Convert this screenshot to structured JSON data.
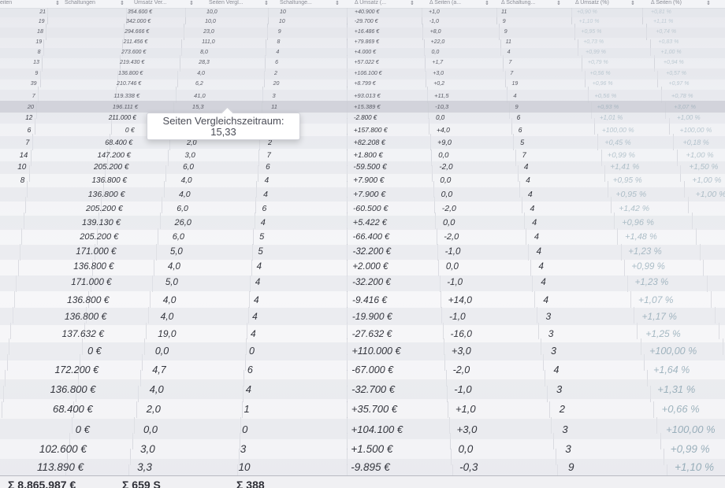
{
  "table": {
    "headers": [
      "eiten",
      "Schaltungen",
      "Umsatz Ver...",
      "Seiten Vergl...",
      "Schaltunge...",
      "Δ Umsatz (...",
      "Δ Seiten (a...",
      "Δ Schaltung...",
      "Δ Umsatz (%)",
      "Δ Seiten (%)"
    ],
    "rows": [
      [
        "21",
        "354.600 €",
        "10,0",
        "10",
        "+40.900 €",
        "+1,0",
        "11",
        "+0,90 %",
        "+0,81 %"
      ],
      [
        "19",
        "342.000 €",
        "10,0",
        "10",
        "-29.700 €",
        "-1,0",
        "9",
        "+1,10 %",
        "+1,11 %"
      ],
      [
        "18",
        "294.666 €",
        "23,0",
        "9",
        "+16.486 €",
        "+8,0",
        "9",
        "+0,95 %",
        "+0,74 %"
      ],
      [
        "19",
        "211.456 €",
        "111,0",
        "8",
        "+79.869 €",
        "+22,0",
        "11",
        "+0,73 %",
        "+0,83 %"
      ],
      [
        "8",
        "273.600 €",
        "8,0",
        "4",
        "+4.000 €",
        "0,0",
        "4",
        "+0,99 %",
        "+1,00 %"
      ],
      [
        "13",
        "219.430 €",
        "28,3",
        "6",
        "+57.022 €",
        "+1,7",
        "7",
        "+0,79 %",
        "+0,94 %"
      ],
      [
        "9",
        "136.800 €",
        "4,0",
        "2",
        "+106.100 €",
        "+3,0",
        "7",
        "+0,56 %",
        "+0,57 %"
      ],
      [
        "39",
        "210.746 €",
        "6,2",
        "20",
        "+8.799 €",
        "+0,2",
        "19",
        "+0,96 %",
        "+0,97 %"
      ],
      [
        "7",
        "119.338 €",
        "41,0",
        "3",
        "+93.013 €",
        "+11,5",
        "4",
        "+0,56 %",
        "+0,78 %"
      ],
      [
        "20",
        "196.111 €",
        "15,3",
        "11",
        "+15.389 €",
        "-10,3",
        "9",
        "+0,93 %",
        "+3,07 %"
      ],
      [
        "12",
        "211.000 €",
        "",
        "",
        "-2.800 €",
        "0,0",
        "6",
        "+1,01 %",
        "+1,00 %"
      ],
      [
        "6",
        "0 €",
        "",
        "",
        "+157.800 €",
        "+4,0",
        "6",
        "+100,00 %",
        "+100,00 %"
      ],
      [
        "7",
        "68.400 €",
        "2,0",
        "2",
        "+82.208 €",
        "+9,0",
        "5",
        "+0,45 %",
        "+0,18 %"
      ],
      [
        "14",
        "147.200 €",
        "3,0",
        "7",
        "+1.800 €",
        "0,0",
        "7",
        "+0,99 %",
        "+1,00 %"
      ],
      [
        "10",
        "205.200 €",
        "6,0",
        "6",
        "-59.500 €",
        "-2,0",
        "4",
        "+1,41 %",
        "+1,50 %"
      ],
      [
        "8",
        "136.800 €",
        "4,0",
        "4",
        "+7.900 €",
        "0,0",
        "4",
        "+0,95 %",
        "+1,00 %"
      ],
      [
        "",
        "136.800 €",
        "4,0",
        "4",
        "+7.900 €",
        "0,0",
        "4",
        "+0,95 %",
        "+1,00 %"
      ],
      [
        "",
        "205.200 €",
        "6,0",
        "6",
        "-60.500 €",
        "-2,0",
        "4",
        "+1,42 %",
        ""
      ],
      [
        "",
        "139.130 €",
        "26,0",
        "4",
        "+5.422 €",
        "0,0",
        "4",
        "+0,96 %",
        ""
      ],
      [
        "",
        "205.200 €",
        "6,0",
        "5",
        "-66.400 €",
        "-2,0",
        "4",
        "+1,48 %",
        ""
      ],
      [
        "",
        "171.000 €",
        "5,0",
        "5",
        "-32.200 €",
        "-1,0",
        "4",
        "+1,23 %",
        ""
      ],
      [
        "",
        "136.800 €",
        "4,0",
        "4",
        "+2.000 €",
        "0,0",
        "4",
        "+0,99 %",
        ""
      ],
      [
        "",
        "171.000 €",
        "5,0",
        "4",
        "-32.200 €",
        "-1,0",
        "4",
        "+1,23 %",
        ""
      ],
      [
        "",
        "136.800 €",
        "4,0",
        "4",
        "-9.416 €",
        "+14,0",
        "4",
        "+1,07 %",
        ""
      ],
      [
        "",
        "136.800 €",
        "4,0",
        "4",
        "-19.900 €",
        "-1,0",
        "3",
        "+1,17 %",
        ""
      ],
      [
        "",
        "137.632 €",
        "19,0",
        "4",
        "-27.632 €",
        "-16,0",
        "3",
        "+1,25 %",
        ""
      ],
      [
        "",
        "0 €",
        "0,0",
        "0",
        "+110.000 €",
        "+3,0",
        "3",
        "+100,00 %",
        ""
      ],
      [
        "",
        "172.200 €",
        "4,7",
        "6",
        "-67.000 €",
        "-2,0",
        "4",
        "+1,64 %",
        ""
      ],
      [
        "",
        "136.800 €",
        "4,0",
        "4",
        "-32.700 €",
        "-1,0",
        "3",
        "+1,31 %",
        ""
      ],
      [
        "",
        "68.400 €",
        "2,0",
        "1",
        "+35.700 €",
        "+1,0",
        "2",
        "+0,66 %",
        ""
      ],
      [
        "",
        "0 €",
        "0,0",
        "0",
        "+104.100 €",
        "+3,0",
        "3",
        "+100,00 %",
        ""
      ],
      [
        "",
        "102.600 €",
        "3,0",
        "3",
        "+1.500 €",
        "0,0",
        "3",
        "+0,99 %",
        ""
      ],
      [
        "",
        "113.890 €",
        "3,3",
        "10",
        "-9.895 €",
        "-0,3",
        "9",
        "+1,10 %",
        ""
      ]
    ],
    "totals": [
      "Σ 8.865.987 €",
      "Σ 659 S",
      "Σ 388"
    ]
  },
  "tooltip": {
    "label": "Seiten Vergleichszeitraum:",
    "value": "15,33"
  }
}
